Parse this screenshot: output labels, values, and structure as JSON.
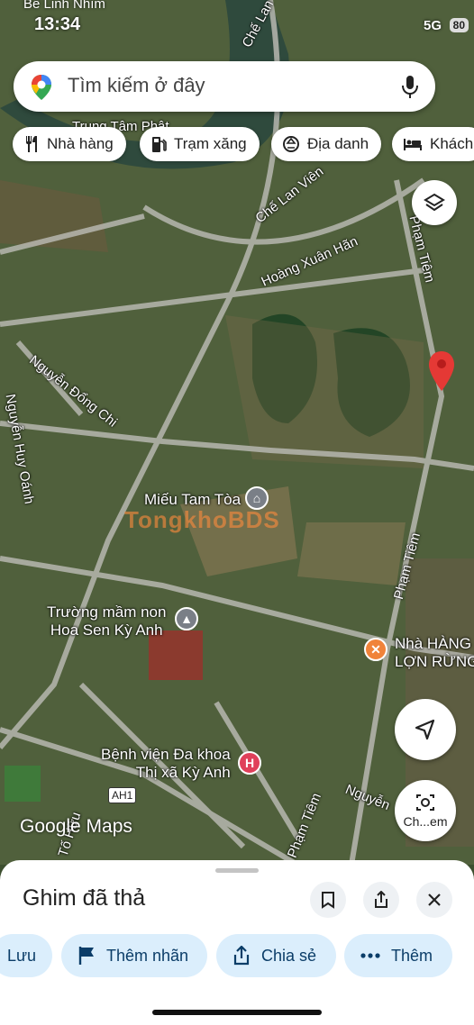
{
  "status_bar": {
    "top_left_label": "Bể Linh Nhìm",
    "time": "13:34",
    "network": "5G",
    "battery": "80"
  },
  "search": {
    "placeholder": "Tìm kiếm ở đây"
  },
  "chips": [
    {
      "label": "Nhà hàng",
      "icon": "fork-knife-icon"
    },
    {
      "label": "Trạm xăng",
      "icon": "gas-pump-icon"
    },
    {
      "label": "Địa danh",
      "icon": "landmark-icon"
    },
    {
      "label": "Khách",
      "icon": "bed-icon"
    }
  ],
  "map": {
    "street_labels": [
      "Chế Lan Viên",
      "Hoàng Xuân Hãn",
      "Phạm Tiêm",
      "Nguyễn Đổng Chi",
      "Nguyễn Huy Oánh",
      "Phạm Tiêm",
      "Phạm Tiêm",
      "Nguyễn",
      "Tố Hữu",
      "Chế Lan"
    ],
    "top_area_label": "Trung Tâm Phật",
    "route_badge": "AH1",
    "pois": [
      {
        "name": "Miếu Tam Tòa",
        "icon": "temple-icon"
      },
      {
        "name": "Trường mầm non\nHoa Sen Kỳ Anh",
        "icon": "school-icon"
      },
      {
        "name": "Nhà HÀNG\nLỢN RỪNG",
        "icon": "restaurant-icon"
      },
      {
        "name": "Bệnh viện Đa khoa\nThị xã Kỳ Anh",
        "icon": "hospital-icon",
        "badge": "H"
      }
    ],
    "watermark": "TongkhoBDS",
    "google_logo": "Google Maps",
    "lens_label": "Ch...em",
    "colors": {
      "pin": "#e53935",
      "restaurant": "#f0833a",
      "hospital": "#e0405a",
      "school": "#7a7f87"
    }
  },
  "sheet": {
    "title": "Ghim đã thả",
    "actions": [
      {
        "label": "Lưu",
        "icon": "bookmark-icon"
      },
      {
        "label": "Thêm nhãn",
        "icon": "flag-icon"
      },
      {
        "label": "Chia sẻ",
        "icon": "share-icon"
      },
      {
        "label": "Thêm",
        "icon": "more-dots-icon"
      }
    ]
  }
}
